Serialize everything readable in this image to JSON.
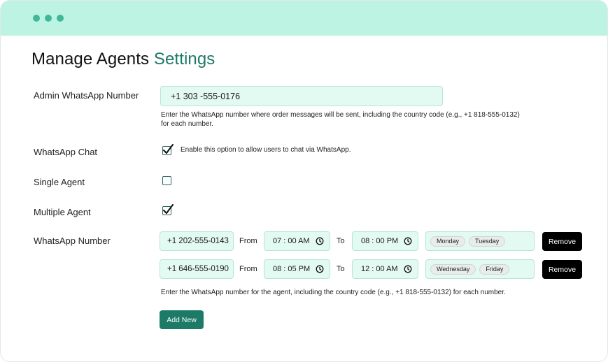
{
  "header": {
    "title_main": "Manage Agents",
    "title_accent": "Settings"
  },
  "admin": {
    "label": "Admin WhatsApp Number",
    "value": "+1 303 -555-0176",
    "help_line1": "Enter the WhatsApp number where order messages will be sent, including the country code (e.g., +1 818-555-0132)",
    "help_line2": "for each number."
  },
  "whatsapp_chat": {
    "label": "WhatsApp Chat",
    "checked": true,
    "description": "Enable this option to allow users to chat via WhatsApp."
  },
  "single_agent": {
    "label": "Single Agent",
    "checked": false
  },
  "multiple_agent": {
    "label": "Multiple Agent",
    "checked": true
  },
  "agents": {
    "label": "WhatsApp Number",
    "from_label": "From",
    "to_label": "To",
    "remove_label": "Remove",
    "rows": [
      {
        "phone": "+1 202-555-0143",
        "from": "07 : 00 AM",
        "to": "08 : 00 PM",
        "days": [
          "Monday",
          "Tuesday"
        ]
      },
      {
        "phone": "+1 646-555-0190",
        "from": "08 : 05 PM",
        "to": "12 : 00 AM",
        "days": [
          "Wednesday",
          "Friday"
        ]
      }
    ],
    "help": "Enter the WhatsApp number for the agent, including the country code (e.g., +1 818-555-0132) for each number.",
    "add_label": "Add New"
  },
  "icons": {
    "window_dots": "traffic-dot",
    "check": "check-icon",
    "clock": "clock-icon"
  },
  "colors": {
    "titlebar": "#bdf3e2",
    "accent": "#1d7a66",
    "input_bg": "#e3faf2"
  }
}
